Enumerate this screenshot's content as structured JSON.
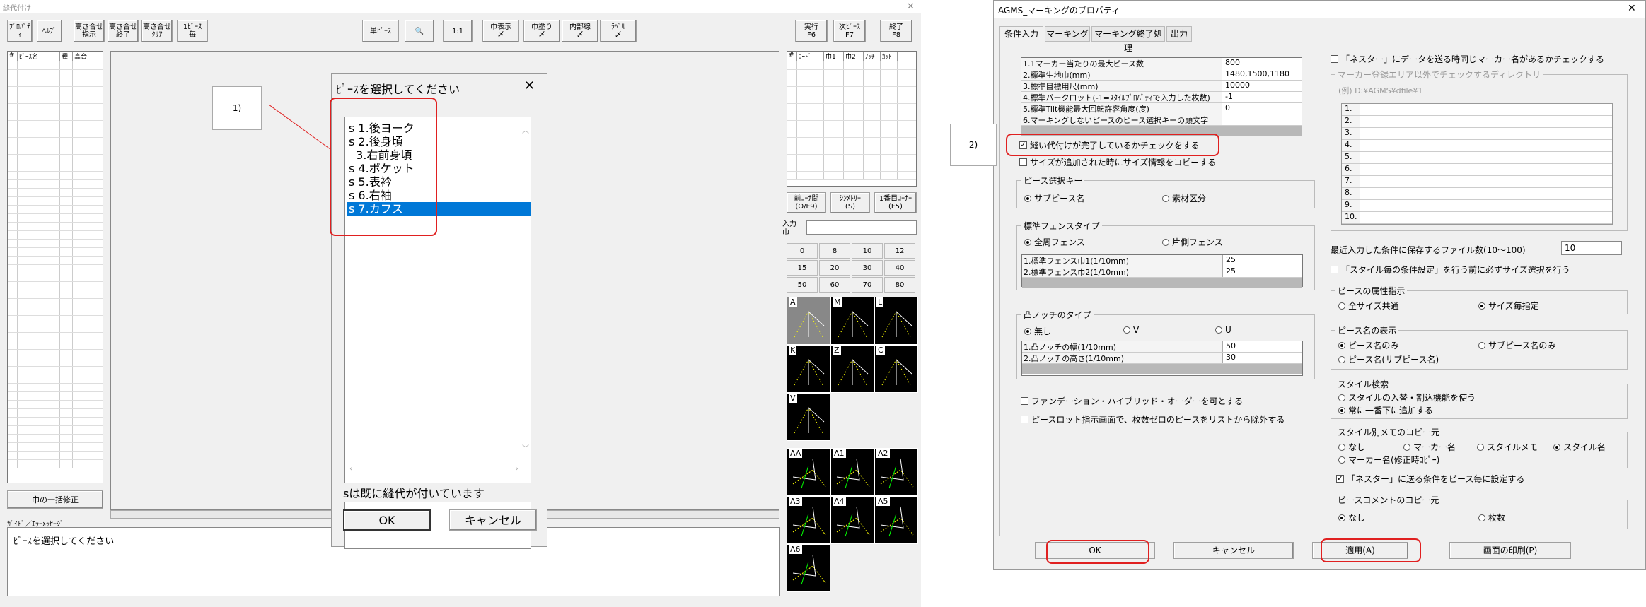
{
  "left_window": {
    "title": "縫代付け",
    "toolbar": [
      {
        "label": "ﾌﾟﾛﾊﾟﾃｨ"
      },
      {
        "label": "ﾍﾙﾌﾟ"
      },
      {
        "label": "高さ合せ\n指示"
      },
      {
        "label": "高さ合せ\n終了"
      },
      {
        "label": "高さ合せ\nｸﾘｱ"
      },
      {
        "label": "1ﾋﾟｰｽ\n毎"
      },
      {
        "label": "単ﾋﾟｰｽ"
      },
      {
        "label": "🔍"
      },
      {
        "label": "1:1"
      },
      {
        "label": "巾表示\n〆"
      },
      {
        "label": "巾塗り\n〆"
      },
      {
        "label": "内部線\n〆"
      },
      {
        "label": "ﾗﾍﾞﾙ\n〆"
      },
      {
        "label": "実行\nF6"
      },
      {
        "label": "次ﾋﾟｰｽ\nF7"
      },
      {
        "label": "終了\nF8"
      }
    ],
    "piece_list_headers": [
      "#",
      "ﾋﾟｰｽ名",
      "種",
      "高合"
    ],
    "right_list_headers": [
      "#",
      "ｺｰﾄﾞ",
      "巾1",
      "巾2",
      "ﾉｯﾁ",
      "ｶｯﾄ"
    ],
    "bulk_button": "巾の一括修正",
    "guide_label": "ｶﾞｲﾄﾞ／ｴﾗｰﾒｯｾｰｼﾞ",
    "guide_text": "ﾋﾟｰｽを選択してください",
    "nav_buttons": [
      "前ｺｰﾅ間\n(O/F9)",
      "ｼﾝﾒﾄﾘｰ\n(S)",
      "1番目ｺｰﾅｰ\n(F5)"
    ],
    "input_label": "入力\n巾",
    "keypad": [
      "0",
      "8",
      "10",
      "12",
      "15",
      "20",
      "30",
      "40",
      "50",
      "60",
      "70",
      "80"
    ],
    "corner_types": [
      "A",
      "M",
      "L",
      "K",
      "Z",
      "C",
      "V"
    ],
    "corner_types2": [
      "AA",
      "A1",
      "A2",
      "A3",
      "A4",
      "A5",
      "A6"
    ]
  },
  "dialog": {
    "title": "ﾋﾟｰｽを選択してください",
    "close": "✕",
    "items": [
      {
        "text": "s 1.後ヨーク",
        "selected": false
      },
      {
        "text": "s 2.後身頃",
        "selected": false
      },
      {
        "text": "  3.右前身頃",
        "selected": false
      },
      {
        "text": "s 4.ポケット",
        "selected": false
      },
      {
        "text": "s 5.表衿",
        "selected": false
      },
      {
        "text": "s 6.右袖",
        "selected": false
      },
      {
        "text": "s 7.カフス",
        "selected": true
      }
    ],
    "note": "sは既に縫代が付いています",
    "ok": "OK",
    "cancel": "キャンセル"
  },
  "marker1": "1)",
  "marker2": "2)",
  "right_window": {
    "title": "AGMS_マーキングのプロパティ",
    "close": "✕",
    "tabs": [
      "条件入力",
      "マーキング",
      "マーキング終了処理",
      "出力"
    ],
    "params": [
      {
        "k": "1.1マーカー当たりの最大ピース数",
        "v": "800"
      },
      {
        "k": "2.標準生地巾(mm)",
        "v": "1480,1500,1180"
      },
      {
        "k": "3.標準目標用尺(mm)",
        "v": "10000"
      },
      {
        "k": "4.標準パークロット(-1=ｽﾀｲﾙﾌﾟﾛﾊﾟﾃｨで入力した枚数)",
        "v": "-1"
      },
      {
        "k": "5.標準Tilt機能最大回転許容角度(度)",
        "v": "0"
      },
      {
        "k": "6.マーキングしないピースのピース選択キーの頭文字",
        "v": ""
      }
    ],
    "check_sewing": "縫い代付けが完了しているかチェックをする",
    "check_size": "サイズが追加された時にサイズ情報をコピーする",
    "piece_key_title": "ピース選択キー",
    "piece_key_opts": [
      "サブピース名",
      "素材区分"
    ],
    "fence_title": "標準フェンスタイプ",
    "fence_opts": [
      "全周フェンス",
      "片側フェンス"
    ],
    "fence_params": [
      {
        "k": "1.標準フェンス巾1(1/10mm)",
        "v": "25"
      },
      {
        "k": "2.標準フェンス巾2(1/10mm)",
        "v": "25"
      }
    ],
    "notch_title": "凸ノッチのタイプ",
    "notch_opts": [
      "無し",
      "V",
      "U"
    ],
    "notch_params": [
      {
        "k": "1.凸ノッチの幅(1/10mm)",
        "v": "50"
      },
      {
        "k": "2.凸ノッチの高さ(1/10mm)",
        "v": "30"
      }
    ],
    "check_foundation": "ファンデーション・ハイブリッド・オーダーを可とする",
    "check_slot": "ピースロット指示画面で、枚数ゼロのピースをリストから除外する",
    "check_nester": "「ネスター」にデータを送る時同じマーカー名があるかチェックする",
    "dir_title": "マーカー登録エリア以外でチェックするディレクトリ",
    "dir_example": "(例) D:¥AGMS¥dfile¥1",
    "dir_rows": [
      "1.",
      "2.",
      "3.",
      "4.",
      "5.",
      "6.",
      "7.",
      "8.",
      "9.",
      "10."
    ],
    "recent_label": "最近入力した条件に保存するファイル数(10～100)",
    "recent_value": "10",
    "check_style_size": "「スタイル毎の条件設定」を行う前に必ずサイズ選択を行う",
    "attr_title": "ピースの属性指示",
    "attr_opts": [
      "全サイズ共通",
      "サイズ毎指定"
    ],
    "name_title": "ピース名の表示",
    "name_opts": [
      "ピース名のみ",
      "サブピース名のみ",
      "ピース名(サブピース名)"
    ],
    "search_title": "スタイル検索",
    "search_opts": [
      "スタイルの入替・割込機能を使う",
      "常に一番下に追加する"
    ],
    "copy_title": "スタイル別メモのコピー元",
    "copy_opts": [
      "なし",
      "マーカー名",
      "スタイルメモ",
      "スタイル名",
      "マーカー名(修正時ｺﾋﾟｰ)"
    ],
    "check_nester_piece": "「ネスター」に送る条件をピース毎に設定する",
    "comment_title": "ピースコメントのコピー元",
    "comment_opts": [
      "なし",
      "枚数"
    ],
    "buttons": [
      "OK",
      "キャンセル",
      "適用(A)",
      "画面の印刷(P)"
    ]
  }
}
